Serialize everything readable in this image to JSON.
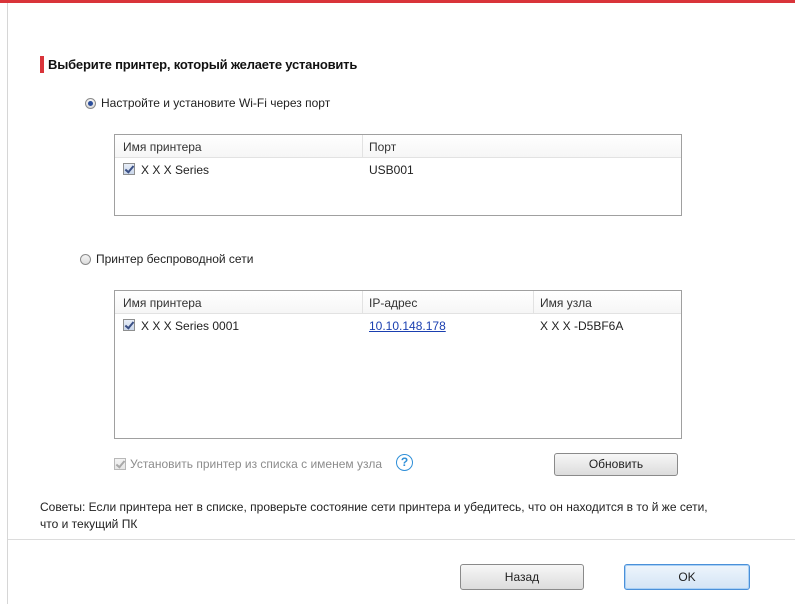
{
  "dialog": {
    "heading": "Выберите принтер, который желаете установить",
    "accent_color": "#d9343a"
  },
  "option_wifi_port": {
    "label": "Настройте и установите Wi-Fi через порт",
    "selected": true
  },
  "usb_list": {
    "columns": [
      "Имя принтера",
      "Порт"
    ],
    "rows": [
      {
        "checked": true,
        "name": "X X X Series",
        "port": "USB001"
      }
    ]
  },
  "option_wireless": {
    "label": "Принтер беспроводной сети",
    "selected": false
  },
  "network_list": {
    "columns": [
      "Имя принтера",
      "IP-адрес",
      "Имя узла"
    ],
    "rows": [
      {
        "checked": true,
        "name": "X X X  Series 0001",
        "ip": "10.10.148.178",
        "hostname": "X X X -D5BF6A"
      }
    ]
  },
  "install_by_hostname": {
    "label": "Установить принтер из списка с именем узла",
    "checked": true,
    "enabled": false
  },
  "help_icon": "question-circle-icon",
  "buttons": {
    "refresh": "Обновить",
    "back": "Назад",
    "ok": "OK"
  },
  "tips": "Советы: Если принтера нет в списке, проверьте состояние сети принтера и убедитесь, что он находится в то й же сети, что и текущий ПК"
}
